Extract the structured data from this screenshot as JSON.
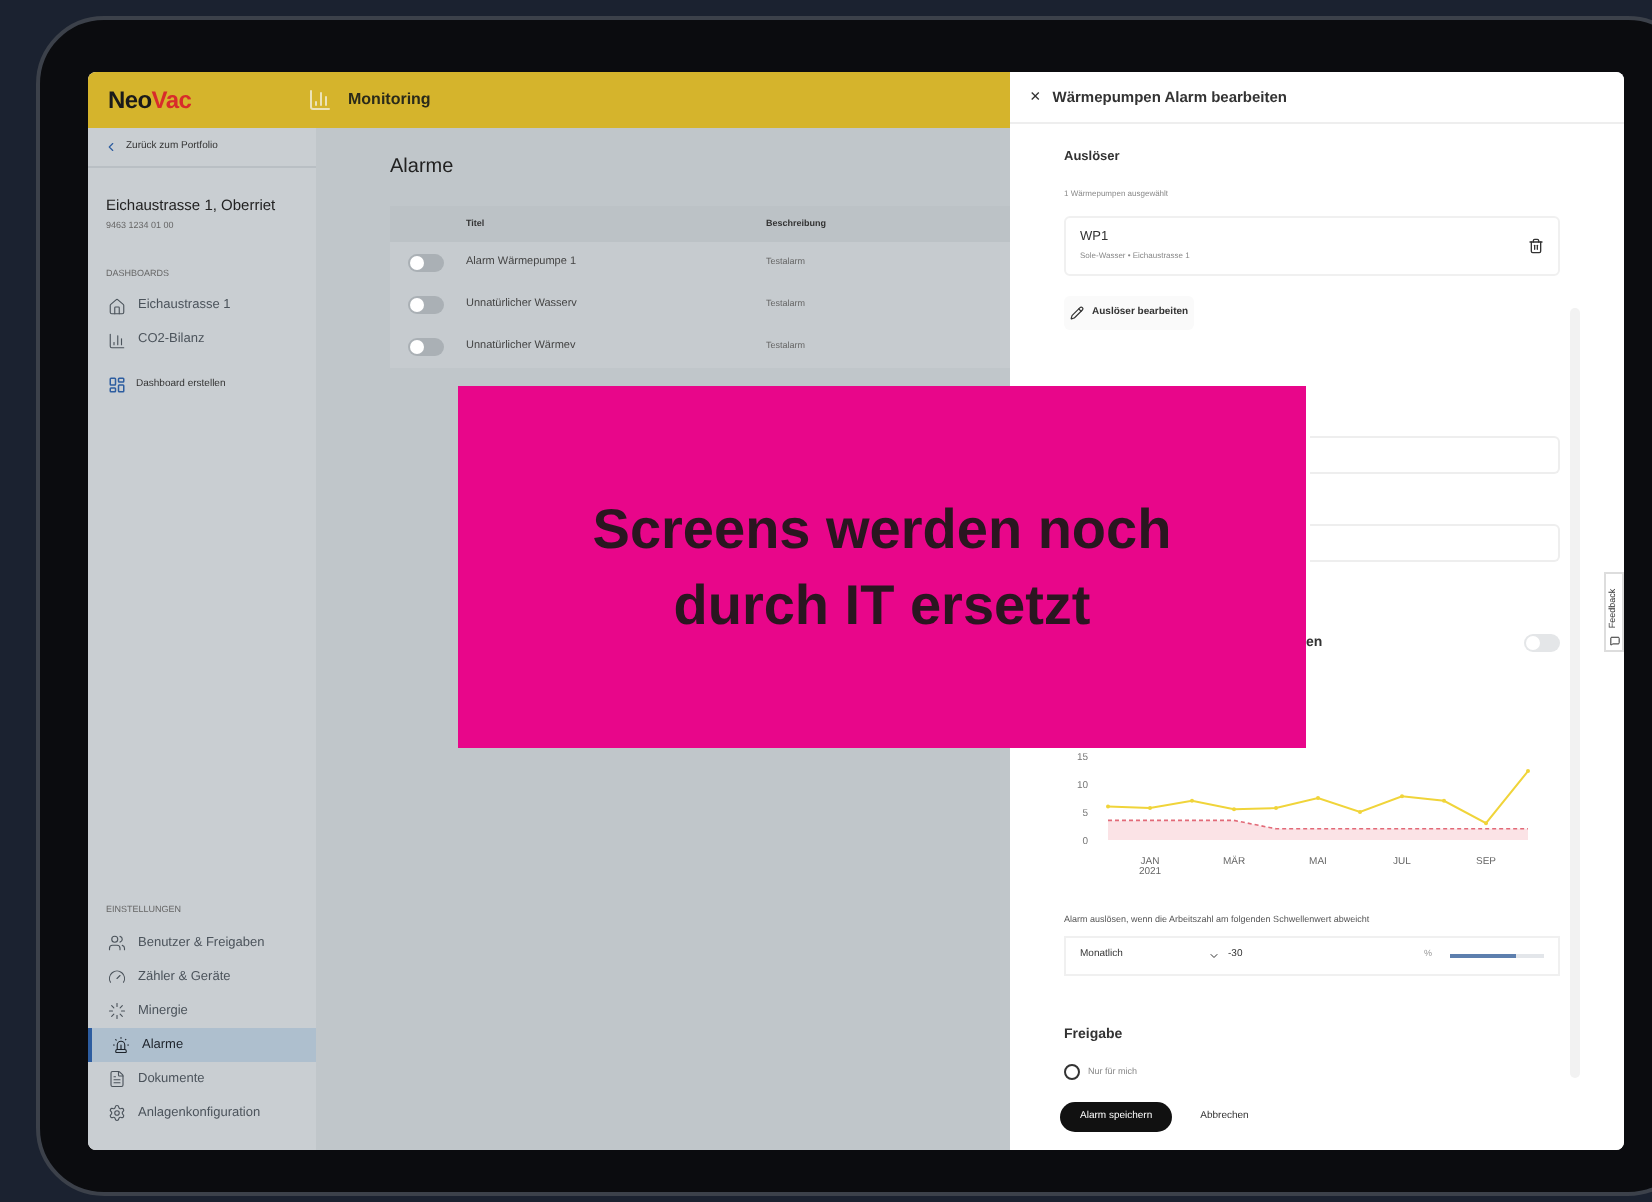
{
  "header": {
    "logo": {
      "text": "Neo",
      "accent": "Vac"
    },
    "title": "Monitoring"
  },
  "sidebar": {
    "back_link": "Zurück zum Portfolio",
    "property": {
      "name": "Eichaustrasse 1, Oberriet",
      "code": "9463 1234 01 00"
    },
    "dashboards": {
      "heading": "DASHBOARDS",
      "items": [
        {
          "label": "Eichaustrasse 1",
          "selected": false
        },
        {
          "label": "CO2-Bilanz",
          "selected": false
        }
      ]
    },
    "create_dashboard": "Dashboard erstellen",
    "settings": {
      "heading": "EINSTELLUNGEN",
      "items": [
        {
          "label": "Benutzer & Freigaben",
          "selected": false
        },
        {
          "label": "Zähler & Geräte",
          "selected": false
        },
        {
          "label": "Minergie",
          "selected": false
        },
        {
          "label": "Alarme",
          "selected": true
        },
        {
          "label": "Dokumente",
          "selected": false
        },
        {
          "label": "Anlagenkonfiguration",
          "selected": false
        }
      ]
    }
  },
  "main": {
    "title": "Alarme",
    "table": {
      "columns": [
        "Titel",
        "Beschreibung"
      ],
      "rows": [
        {
          "on": false,
          "title": "Alarm Wärmepumpe 1",
          "description": "Testalarm"
        },
        {
          "on": false,
          "title": "Unnatürlicher Wasserv",
          "description": "Testalarm"
        },
        {
          "on": false,
          "title": "Unnatürlicher Wärmev",
          "description": "Testalarm"
        }
      ]
    }
  },
  "drawer": {
    "close": "×",
    "title": "Wärmepumpen Alarm bearbeiten",
    "trigger": {
      "heading": "Auslöser",
      "subtitle": "1 Wärmepumpen ausgewählt",
      "device": {
        "name": "WP1",
        "detail": "Sole-Wasser • Eichaustrasse 1"
      },
      "edit_button": "Auslöser bearbeiten"
    },
    "toggle_row": {
      "label": "en",
      "on": false
    },
    "chart_data": {
      "type": "line",
      "categories": [
        null,
        "JAN 2021",
        null,
        "MÄR",
        null,
        "MAI",
        null,
        "JUL",
        null,
        "SEP",
        null
      ],
      "yticks": [
        0,
        5,
        10,
        15
      ],
      "ylim": [
        0,
        15
      ],
      "series": [
        {
          "color": "#f0d43a",
          "line_style": "solid",
          "type": "line",
          "values": [
            6,
            5.7,
            7,
            5.5,
            5.7,
            7.5,
            5,
            7.8,
            7,
            3,
            12.3
          ]
        },
        {
          "color": "#e26a78",
          "line_style": "dashed",
          "type": "area",
          "values": [
            3.5,
            3.5,
            3.5,
            3.5,
            2,
            2,
            2,
            2,
            2,
            2,
            2
          ]
        }
      ]
    },
    "threshold": {
      "label": "Alarm auslösen, wenn die Arbeitszahl am folgenden Schwellenwert abweicht",
      "period": "Monatlich",
      "value": "-30",
      "unit": "%",
      "level": 0.7
    },
    "sharing": {
      "heading": "Freigabe",
      "options": [
        {
          "label": "Nur für mich",
          "selected": false
        }
      ]
    },
    "buttons": {
      "save": "Alarm speichern",
      "cancel": "Abbrechen"
    },
    "feedback": "Feedback"
  },
  "overlay": {
    "lines": [
      "Screens werden noch",
      "durch IT ersetzt"
    ]
  }
}
